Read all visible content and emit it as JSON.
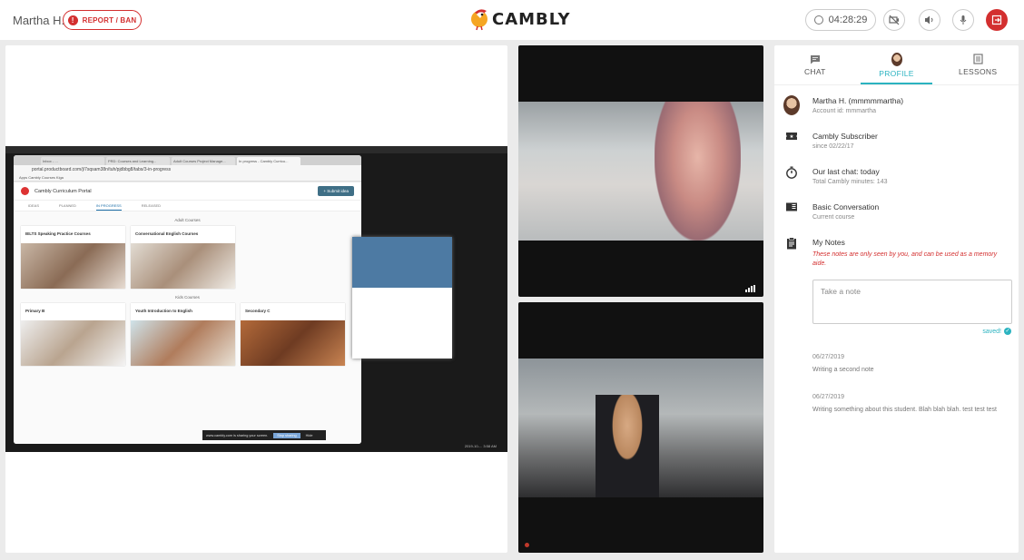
{
  "header": {
    "user_name": "Martha H.",
    "report_label": "REPORT / BAN",
    "logo_text": "CAMBLY",
    "timer": "04:28:29",
    "icons": [
      "video-off-icon",
      "volume-icon",
      "microphone-icon",
      "exit-icon"
    ]
  },
  "shared_screen": {
    "tabs": [
      "Inbox - ...",
      "PRD: Courses and Learning...",
      "Adult Courses Project Manage...",
      "In progress - Cambly Curricu..."
    ],
    "url": "portal.productboard.com/j/7sqsam38n/tuh/pjdbbg8/tabs/3-in-progress",
    "bookmarks": "Apps   Cambly   Courses   Kiga",
    "portal_title": "Cambly Curriculum Portal",
    "submit_label": "+ Submit idea",
    "nav": [
      "IDEAS",
      "PLANNED",
      "IN PROGRESS",
      "RELEASED"
    ],
    "adult_section": "Adult Courses",
    "kids_section": "Kids Courses",
    "adult_cards": [
      "IELTS Speaking Practice Courses",
      "Conversational English Courses"
    ],
    "kids_cards": [
      "Primary B",
      "Youth Introduction to English",
      "Secondary C"
    ],
    "share_banner": "www.cambly.com is sharing your screen.",
    "stop_label": "Stop sharing",
    "hide_label": "Hide",
    "timestamp": "2019-10-... 3:58 AM"
  },
  "tabs": [
    {
      "label": "CHAT",
      "icon": "chat-icon"
    },
    {
      "label": "PROFILE",
      "icon": "profile-avatar-icon"
    },
    {
      "label": "LESSONS",
      "icon": "lessons-icon"
    }
  ],
  "profile": {
    "name": "Martha H. (mmmmmartha)",
    "account": "Account id: mmmartha",
    "subscriber": "Cambly Subscriber",
    "since": "since 02/22/17",
    "last_chat": "Our last chat: today",
    "total_minutes": "Total Cambly minutes: 143",
    "course": "Basic Conversation",
    "course_sub": "Current course",
    "notes_title": "My Notes",
    "notes_disclaimer": "These notes are only seen by you, and can be used as a memory aide.",
    "note_placeholder": "Take a note",
    "saved": "saved!"
  },
  "notes": [
    {
      "date": "06/27/2019",
      "text": "Writing a second note"
    },
    {
      "date": "06/27/2019",
      "text": "Writing something about this student. Blah blah blah. test test test"
    }
  ],
  "colors": {
    "accent": "#2bb3c0",
    "danger": "#d32f2f"
  }
}
